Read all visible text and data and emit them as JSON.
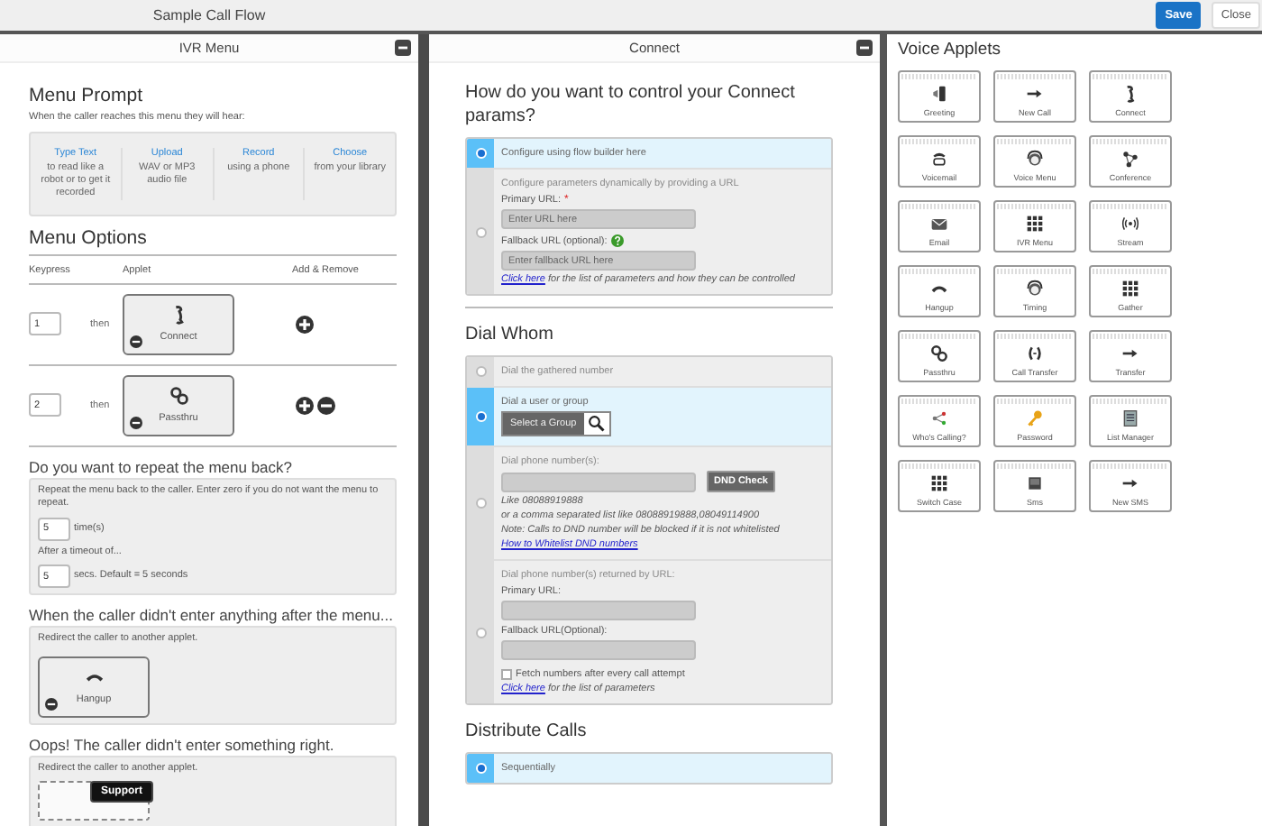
{
  "top_bar": {
    "title": "Sample Call Flow",
    "buttons": [
      {
        "label": "Save",
        "kind": "primary"
      },
      {
        "label": "Close",
        "kind": "plain"
      }
    ]
  },
  "ivr_panel": {
    "title": "IVR Menu",
    "menu_prompt": {
      "heading": "Menu Prompt",
      "hint": "When the caller reaches this menu they will hear:",
      "options": [
        {
          "title": "Type Text",
          "text": "to read like a robot or to get it recorded"
        },
        {
          "title": "Upload",
          "text": "WAV or MP3 audio file"
        },
        {
          "title": "Record",
          "text": "using a phone"
        },
        {
          "title": "Choose",
          "text": "from your library"
        }
      ]
    },
    "menu_options": {
      "heading": "Menu Options",
      "columns": [
        "Keypress",
        "Applet",
        "Add & Remove"
      ],
      "rows": [
        {
          "key": "1",
          "then": "then",
          "applet": "Connect",
          "removable": false
        },
        {
          "key": "2",
          "then": "then",
          "applet": "Passthru",
          "removable": true
        }
      ]
    },
    "repeat": {
      "heading": "Do you want to repeat the menu back?",
      "hint": "Repeat the menu back to the caller. Enter zero if you do not want the menu to repeat.",
      "times_value": "5",
      "times_label": "time(s)",
      "timeout_label": "After a timeout of...",
      "timeout_value": "5",
      "timeout_unit": "secs. Default = 5 seconds"
    },
    "no_input": {
      "heading": "When the caller didn't enter anything after the menu...",
      "hint": "Redirect the caller to another applet.",
      "applet": "Hangup"
    },
    "invalid": {
      "heading": "Oops! The caller didn't enter something right.",
      "hint": "Redirect the caller to another applet."
    },
    "support_button": "Support"
  },
  "connect_panel": {
    "title": "Connect",
    "sections": [
      {
        "heading": "How do you want to control your Connect params?",
        "options": [
          {
            "selected": true,
            "label": "Configure using flow builder here"
          },
          {
            "selected": false,
            "label": "Configure parameters dynamically by providing a URL",
            "fields": [
              {
                "label": "Primary URL:",
                "required": "*",
                "placeholder": "Enter URL here"
              },
              {
                "label": "Fallback URL (optional):",
                "help": true,
                "placeholder": "Enter fallback URL here"
              }
            ],
            "link": "Click here",
            "link_rest": "for the list of parameters and how they can be controlled"
          }
        ]
      },
      {
        "heading": "Dial Whom",
        "options": [
          {
            "selected": false,
            "label": "Dial the gathered number"
          },
          {
            "selected": true,
            "label": "Dial a user or group",
            "group_button": "Select a Group"
          },
          {
            "selected": false,
            "label": "Dial phone number(s):",
            "fields": [
              {
                "button": "DND Check"
              }
            ],
            "notes": [
              "Like 08088919888",
              "or a comma separated list like 08088919888,08049114900",
              "Note: Calls to DND number will be blocked if it is not whitelisted"
            ],
            "link": "How to Whitelist DND numbers"
          },
          {
            "selected": false,
            "label": "Dial phone number(s) returned by URL:",
            "fields": [
              {
                "label": "Primary URL:"
              },
              {
                "label": "Fallback URL(Optional):"
              }
            ],
            "checkbox": {
              "label": "Fetch numbers after every call attempt",
              "checked": false
            },
            "link": "Click here",
            "link_rest": "for the list of parameters"
          }
        ]
      },
      {
        "heading": "Distribute Calls",
        "options": [
          {
            "selected": true,
            "label": "Sequentially"
          }
        ]
      }
    ]
  },
  "applets": {
    "heading": "Voice Applets",
    "items": [
      "Greeting",
      "New Call",
      "Connect",
      "Voicemail",
      "Voice Menu",
      "Conference",
      "Email",
      "IVR Menu",
      "Stream",
      "Hangup",
      "Timing",
      "Gather",
      "Passthru",
      "Call Transfer",
      "Transfer",
      "Who's Calling?",
      "Password",
      "List Manager",
      "Switch Case",
      "Sms",
      "New SMS"
    ]
  }
}
